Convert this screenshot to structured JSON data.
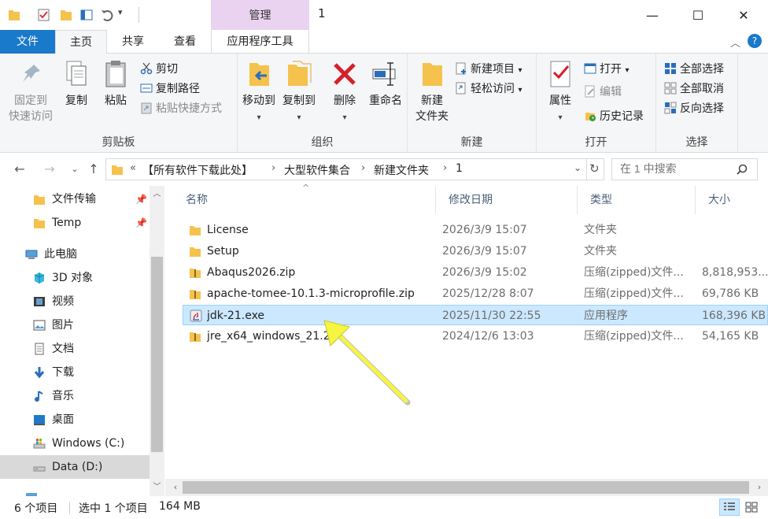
{
  "window": {
    "title": "1",
    "contextual_tab_group": "管理",
    "controls": {
      "minimize": "—",
      "maximize": "☐",
      "close": "✕"
    }
  },
  "tabs": {
    "file": "文件",
    "home": "主页",
    "share": "共享",
    "view": "查看",
    "app_tools": "应用程序工具"
  },
  "ribbon": {
    "clipboard": {
      "label": "剪贴板",
      "pin_quick_access": [
        "固定到",
        "快速访问"
      ],
      "copy": "复制",
      "paste": "粘贴",
      "cut": "剪切",
      "copy_path": "复制路径",
      "paste_shortcut": "粘贴快捷方式"
    },
    "organize": {
      "label": "组织",
      "move_to": "移动到",
      "copy_to": "复制到",
      "delete": "删除",
      "rename": "重命名"
    },
    "new": {
      "label": "新建",
      "new_folder": [
        "新建",
        "文件夹"
      ],
      "new_item": "新建项目",
      "easy_access": "轻松访问"
    },
    "open": {
      "label": "打开",
      "properties": "属性",
      "open": "打开",
      "edit": "编辑",
      "history": "历史记录"
    },
    "select": {
      "label": "选择",
      "select_all": "全部选择",
      "select_none": "全部取消",
      "invert": "反向选择"
    }
  },
  "address": {
    "crumbs": [
      "【所有软件下载此处】",
      "大型软件集合",
      "新建文件夹",
      "1"
    ],
    "overflow": "«",
    "search_placeholder": "在 1 中搜索"
  },
  "nav": {
    "items": [
      {
        "label": "文件传输",
        "icon": "folder-icon",
        "pinned": true
      },
      {
        "label": "Temp",
        "icon": "folder-icon",
        "pinned": true
      },
      {
        "label": "此电脑",
        "icon": "computer-icon",
        "pinned": false
      },
      {
        "label": "3D 对象",
        "icon": "3d-objects-icon",
        "pinned": false
      },
      {
        "label": "视频",
        "icon": "video-icon",
        "pinned": false
      },
      {
        "label": "图片",
        "icon": "pictures-icon",
        "pinned": false
      },
      {
        "label": "文档",
        "icon": "documents-icon",
        "pinned": false
      },
      {
        "label": "下载",
        "icon": "downloads-icon",
        "pinned": false
      },
      {
        "label": "音乐",
        "icon": "music-icon",
        "pinned": false
      },
      {
        "label": "桌面",
        "icon": "desktop-icon",
        "pinned": false
      },
      {
        "label": "Windows (C:)",
        "icon": "drive-c-icon",
        "pinned": false
      },
      {
        "label": "Data (D:)",
        "icon": "drive-d-icon",
        "pinned": false
      }
    ],
    "partial_label": "..."
  },
  "columns": {
    "name": "名称",
    "modified": "修改日期",
    "type": "类型",
    "size": "大小"
  },
  "files": [
    {
      "name": "License",
      "modified": "2026/3/9 15:07",
      "type": "文件夹",
      "size": "",
      "icon": "folder-icon"
    },
    {
      "name": "Setup",
      "modified": "2026/3/9 15:07",
      "type": "文件夹",
      "size": "",
      "icon": "folder-icon"
    },
    {
      "name": "Abaqus2026.zip",
      "modified": "2026/3/9 15:02",
      "type": "压缩(zipped)文件...",
      "size": "8,818,953...",
      "icon": "zip-icon"
    },
    {
      "name": "apache-tomee-10.1.3-microprofile.zip",
      "modified": "2025/12/28 8:07",
      "type": "压缩(zipped)文件...",
      "size": "69,786 KB",
      "icon": "zip-icon"
    },
    {
      "name": "jdk-21.exe",
      "modified": "2025/11/30 22:55",
      "type": "应用程序",
      "size": "168,396 KB",
      "icon": "installer-icon",
      "selected": true
    },
    {
      "name": "jre_x64_windows_21.2",
      "modified": "2024/12/6 13:03",
      "type": "压缩(zipped)文件...",
      "size": "54,165 KB",
      "icon": "zip-icon"
    }
  ],
  "status": {
    "count": "6 个项目",
    "selection": "选中 1 个项目",
    "size": "164 MB"
  },
  "colors": {
    "file_tab": "#1979ca",
    "manage_tab": "#ead3f0",
    "selection": "#cce8ff",
    "annotation_arrow": "#f5f542"
  }
}
